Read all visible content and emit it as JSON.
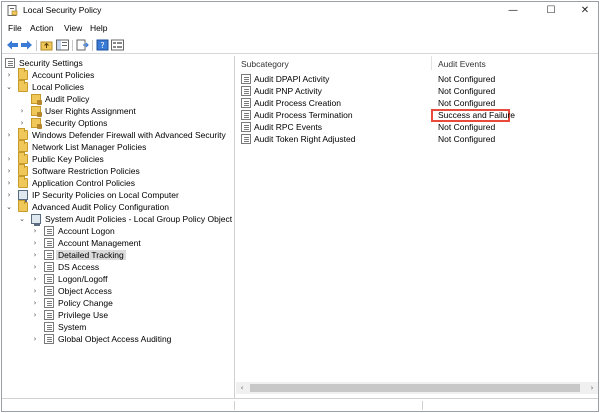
{
  "window": {
    "title": "Local Security Policy"
  },
  "menu": [
    "File",
    "Action",
    "View",
    "Help"
  ],
  "tree": {
    "root": "Security Settings",
    "account_policies": "Account Policies",
    "local_policies": "Local Policies",
    "audit_policy": "Audit Policy",
    "user_rights": "User Rights Assignment",
    "security_options": "Security Options",
    "firewall": "Windows Defender Firewall with Advanced Security",
    "network_list": "Network List Manager Policies",
    "public_key": "Public Key Policies",
    "software_restriction": "Software Restriction Policies",
    "app_control": "Application Control Policies",
    "ip_security": "IP Security Policies on Local Computer",
    "advanced_audit": "Advanced Audit Policy Configuration",
    "system_audit": "System Audit Policies - Local Group Policy Object",
    "account_logon": "Account Logon",
    "account_management": "Account Management",
    "detailed_tracking": "Detailed Tracking",
    "ds_access": "DS Access",
    "logon_logoff": "Logon/Logoff",
    "object_access": "Object Access",
    "policy_change": "Policy Change",
    "privilege_use": "Privilege Use",
    "system": "System",
    "global_object": "Global Object Access Auditing"
  },
  "list": {
    "col_subcategory": "Subcategory",
    "col_audit_events": "Audit Events",
    "rows": [
      {
        "subcategory": "Audit DPAPI Activity",
        "events": "Not Configured"
      },
      {
        "subcategory": "Audit PNP Activity",
        "events": "Not Configured"
      },
      {
        "subcategory": "Audit Process Creation",
        "events": "Not Configured"
      },
      {
        "subcategory": "Audit Process Termination",
        "events": "Success and Failure"
      },
      {
        "subcategory": "Audit RPC Events",
        "events": "Not Configured"
      },
      {
        "subcategory": "Audit Token Right Adjusted",
        "events": "Not Configured"
      }
    ]
  },
  "colors": {
    "highlight_border": "#e84b3c",
    "folder": "#f0c85a"
  }
}
